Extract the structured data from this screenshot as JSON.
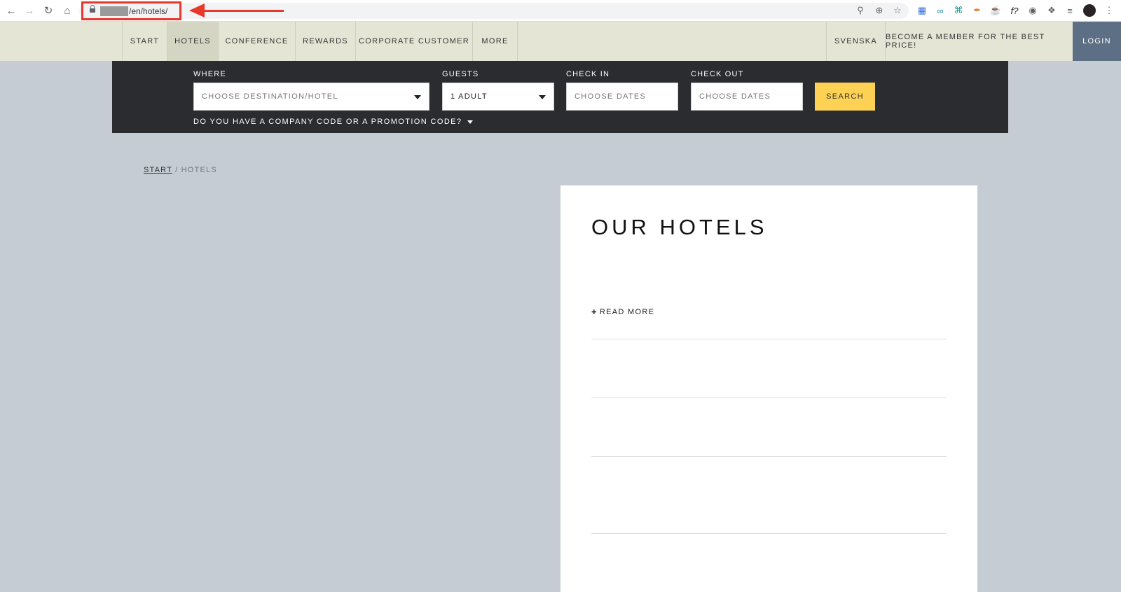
{
  "browser": {
    "url_path": "/en/hotels/",
    "icons": [
      "back-icon",
      "forward-icon",
      "reload-icon",
      "home-icon",
      "key-icon",
      "zoom-icon",
      "star-icon",
      "extension-icons",
      "puzzle-icon",
      "menu-icon"
    ]
  },
  "header": {
    "nav": [
      "START",
      "HOTELS",
      "CONFERENCE",
      "REWARDS",
      "CORPORATE CUSTOMER",
      "MORE"
    ],
    "language": "SVENSKA",
    "member_cta": "BECOME A MEMBER FOR THE BEST PRICE!",
    "login": "LOGIN"
  },
  "search": {
    "where_label": "WHERE",
    "where_value": "CHOOSE DESTINATION/HOTEL",
    "guests_label": "GUESTS",
    "guests_value": "1 ADULT",
    "checkin_label": "CHECK IN",
    "checkin_placeholder": "CHOOSE DATES",
    "checkout_label": "CHECK OUT",
    "checkout_placeholder": "CHOOSE DATES",
    "button": "SEARCH",
    "promo": "DO YOU HAVE A COMPANY CODE OR A PROMOTION CODE?"
  },
  "breadcrumb": {
    "home": "START",
    "separator": "/",
    "current": "HOTELS"
  },
  "content": {
    "title": "OUR HOTELS",
    "read_more": "READ MORE"
  },
  "colors": {
    "page_bg": "#c5ccd3",
    "header_bg": "#e5e5d6",
    "search_panel_bg": "#2b2c30",
    "search_button": "#fdd154",
    "login_bg": "#5d6f84",
    "annotation_red": "#e8372b"
  }
}
